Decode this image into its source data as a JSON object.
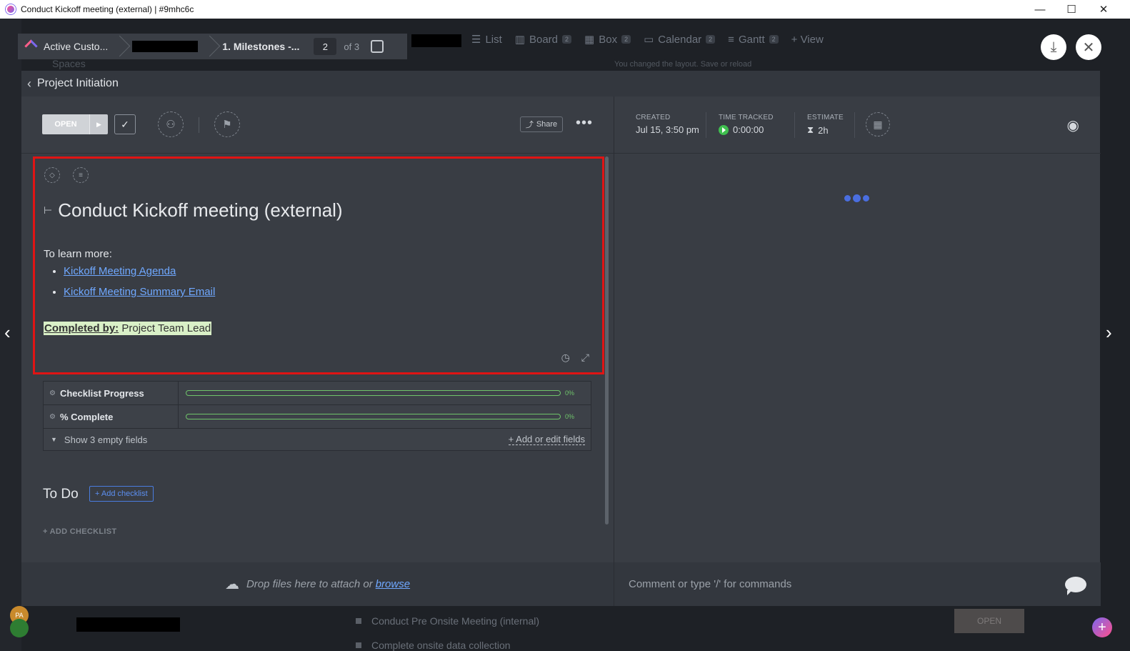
{
  "window": {
    "title": "Conduct Kickoff meeting (external) | #9mhc6c",
    "minimize": "—",
    "maximize": "☐",
    "close": "✕"
  },
  "background": {
    "spaces_label": "Spaces",
    "views": [
      {
        "label": "List",
        "icon": "list-icon",
        "count": ""
      },
      {
        "label": "Board",
        "icon": "board-icon",
        "count": "2"
      },
      {
        "label": "Box",
        "icon": "box-icon",
        "count": "2"
      },
      {
        "label": "Calendar",
        "icon": "calendar-icon",
        "count": "2"
      },
      {
        "label": "Gantt",
        "icon": "gantt-icon",
        "count": "2"
      },
      {
        "label": "+ View",
        "icon": "",
        "count": ""
      }
    ],
    "notice": "You changed the layout. Save or reload",
    "rows": [
      {
        "name": "Conduct Pre Onsite Meeting (internal)",
        "status": "OPEN"
      },
      {
        "name": "Complete onsite data collection",
        "status": "OPEN"
      }
    ],
    "avatar_initials": "PA"
  },
  "breadcrumb": {
    "workspace": "Active Custo...",
    "list": "1. Milestones -...",
    "page_current": "2",
    "page_of": "of 3"
  },
  "modal": {
    "back_label": "Project Initiation",
    "status": "OPEN",
    "share_label": "Share",
    "more_label": "•••",
    "task_title": "Conduct Kickoff meeting (external)",
    "desc_intro": "To learn more:",
    "links": [
      "Kickoff Meeting Agenda",
      "Kickoff Meeting Summary Email"
    ],
    "completed_by_label": "Completed by:",
    "completed_by_value": "Project Team Lead",
    "fields": [
      {
        "name": "Checklist Progress",
        "value_text": "0%",
        "progress": 0
      },
      {
        "name": "% Complete",
        "value_text": "0%",
        "progress": 0
      }
    ],
    "show_empty": "Show 3 empty fields",
    "add_fields": "+ Add or edit fields",
    "todo_heading": "To Do",
    "add_checklist_btn": "+ Add checklist",
    "add_checklist_link": "+ ADD CHECKLIST",
    "drop_text": "Drop files here to attach or",
    "browse_link": "browse"
  },
  "details": {
    "created_label": "CREATED",
    "created_value": "Jul 15, 3:50 pm",
    "time_tracked_label": "TIME TRACKED",
    "time_tracked_value": "0:00:00",
    "estimate_label": "ESTIMATE",
    "estimate_value": "2h",
    "comment_placeholder": "Comment or type '/' for commands"
  },
  "colors": {
    "highlight_border": "#e01414",
    "link": "#6fa8ff",
    "progress": "#6fc46a",
    "accent": "#7b68ee"
  }
}
